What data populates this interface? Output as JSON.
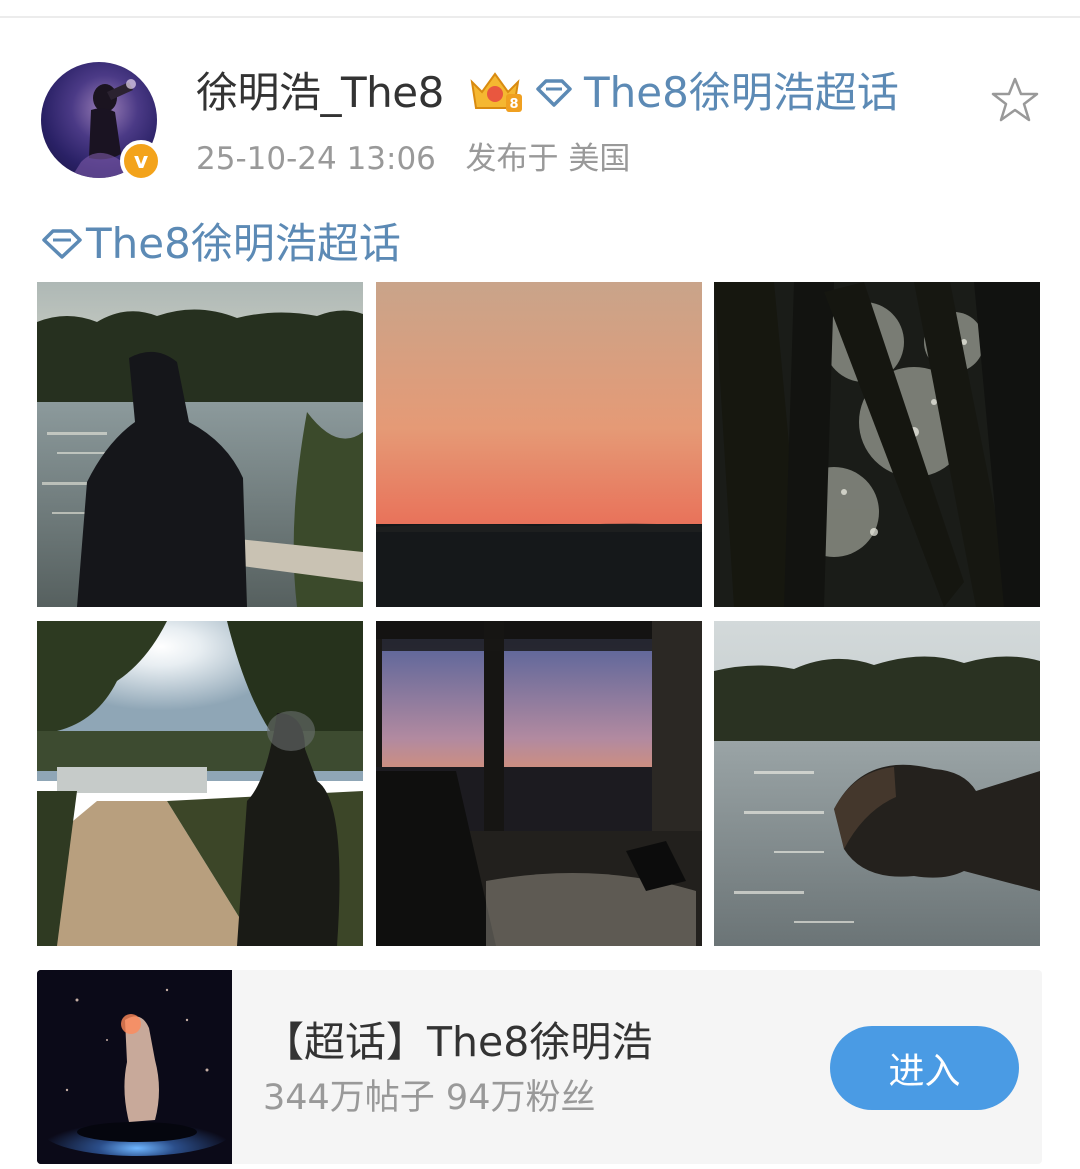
{
  "post": {
    "username": "徐明浩_The8",
    "super_topic_tag": "The8徐明浩超话",
    "timestamp": "25-10-24 13:06",
    "location_text": "发布于 美国",
    "verified_badge": "v",
    "topic_link": "The8徐明浩超话"
  },
  "photos": [
    {
      "scene": "silhouette-by-lake"
    },
    {
      "scene": "sunset-sky"
    },
    {
      "scene": "tree-silhouettes-water"
    },
    {
      "scene": "path-to-lake-sun"
    },
    {
      "scene": "window-dusk"
    },
    {
      "scene": "lake-head-bowed"
    }
  ],
  "topic_card": {
    "title": "【超话】The8徐明浩",
    "stats": "344万帖子 94万粉丝",
    "enter_label": "进入"
  },
  "colors": {
    "link_blue": "#5c8ab5",
    "button_blue": "#4a9be4",
    "verified_orange": "#f3a31b"
  },
  "icons": [
    "crown-badge-icon",
    "super-topic-diamond-icon",
    "favorite-star-icon",
    "verified-icon"
  ]
}
